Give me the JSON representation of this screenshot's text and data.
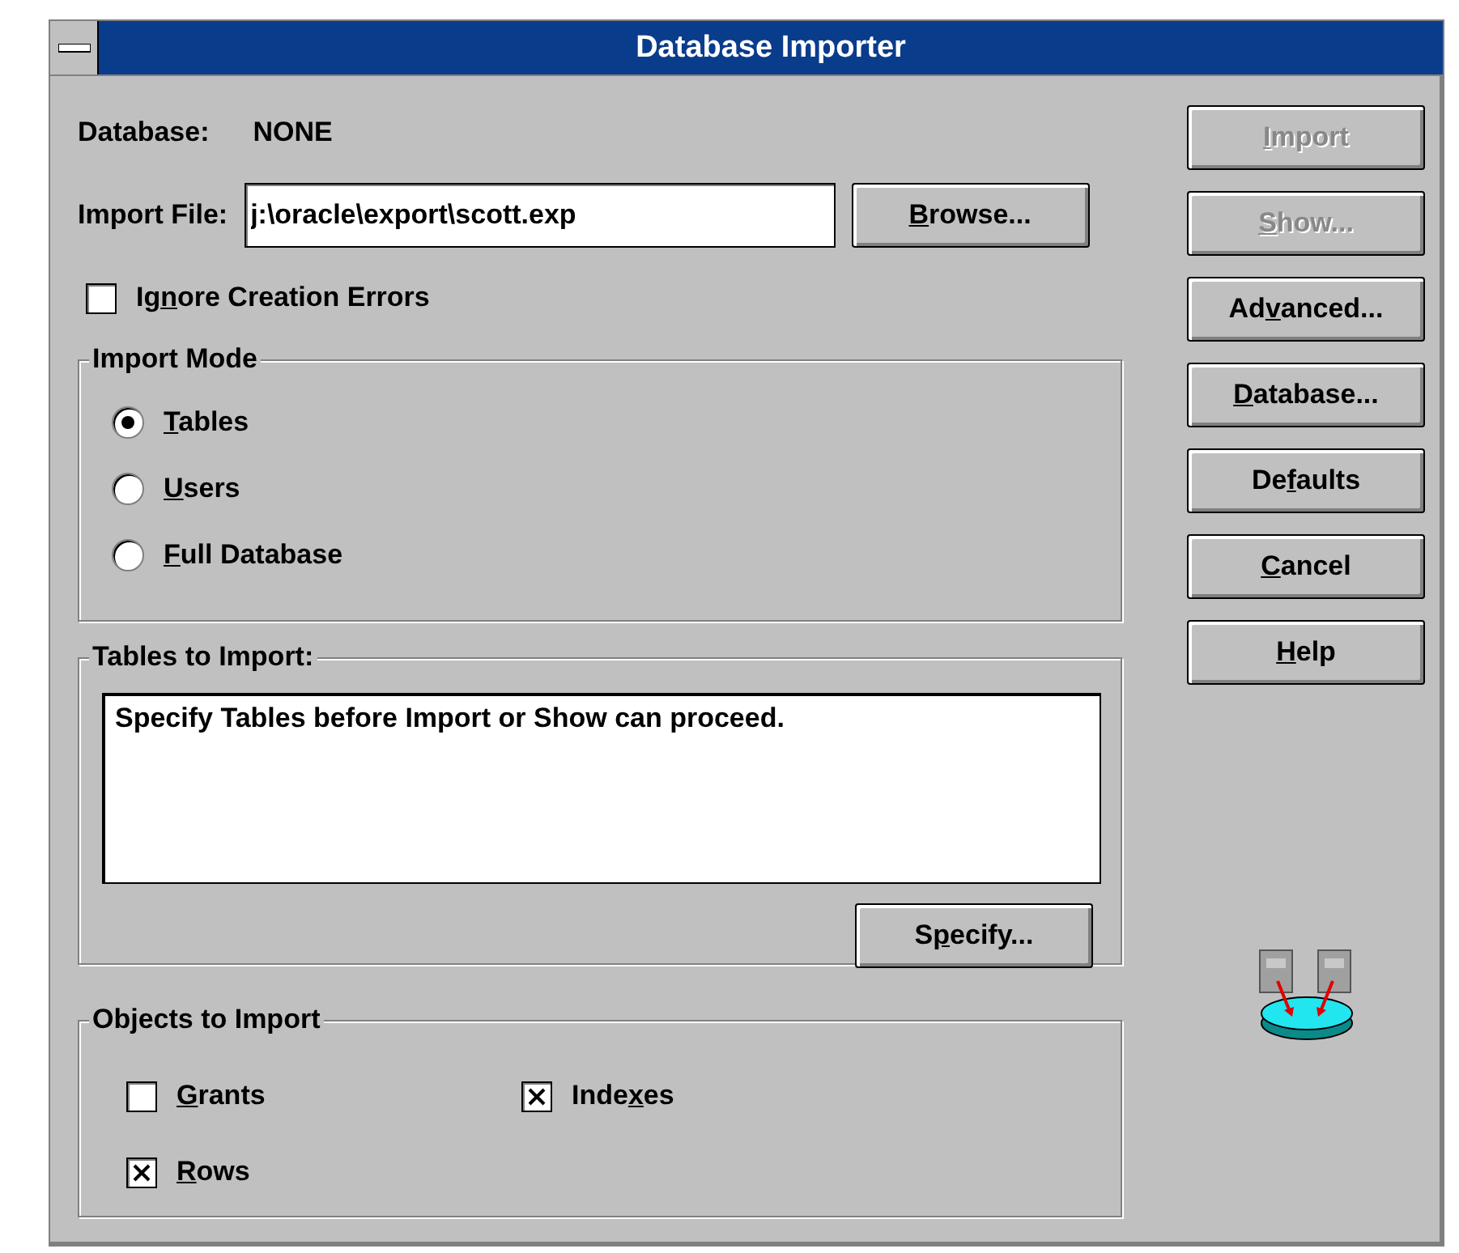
{
  "window": {
    "title": "Database Importer"
  },
  "database": {
    "label": "Database:",
    "value": "NONE"
  },
  "import_file": {
    "label": "Import File:",
    "value": "j:\\oracle\\export\\scott.exp"
  },
  "browse_button": {
    "label": {
      "key": "B",
      "post": "rowse..."
    },
    "disabled": false
  },
  "ignore_errors": {
    "label": {
      "pre": "Ig",
      "key": "n",
      "post": "ore Creation Errors"
    },
    "checked": false
  },
  "import_mode": {
    "title": "Import Mode",
    "options": [
      {
        "label": {
          "key": "T",
          "post": "ables"
        },
        "selected": true
      },
      {
        "label": {
          "key": "U",
          "post": "sers"
        },
        "selected": false
      },
      {
        "label": {
          "key": "F",
          "post": "ull Database"
        },
        "selected": false
      }
    ]
  },
  "tables_to_import": {
    "title": "Tables to Import:",
    "message": "Specify Tables before Import or Show can proceed.",
    "button": {
      "label": {
        "pre": "S",
        "key": "p",
        "post": "ecify..."
      },
      "disabled": false
    }
  },
  "objects_to_import": {
    "title": "Objects to Import",
    "options": [
      {
        "label": {
          "key": "G",
          "post": "rants"
        },
        "checked": false
      },
      {
        "label": {
          "pre": "Inde",
          "key": "x",
          "post": "es"
        },
        "checked": true
      },
      {
        "label": {
          "key": "R",
          "post": "ows"
        },
        "checked": true
      }
    ]
  },
  "buttons": [
    {
      "label": {
        "key": "I",
        "post": "mport"
      },
      "disabled": true
    },
    {
      "label": {
        "key": "S",
        "post": "how..."
      },
      "disabled": true
    },
    {
      "label": {
        "pre": "Ad",
        "key": "v",
        "post": "anced..."
      },
      "disabled": false
    },
    {
      "label": {
        "key": "D",
        "post": "atabase..."
      },
      "disabled": false
    },
    {
      "label": {
        "pre": "De",
        "key": "f",
        "post": "aults"
      },
      "disabled": false
    },
    {
      "label": {
        "key": "C",
        "post": "ancel"
      },
      "disabled": false
    },
    {
      "label": {
        "key": "H",
        "post": "elp"
      },
      "disabled": false
    }
  ]
}
